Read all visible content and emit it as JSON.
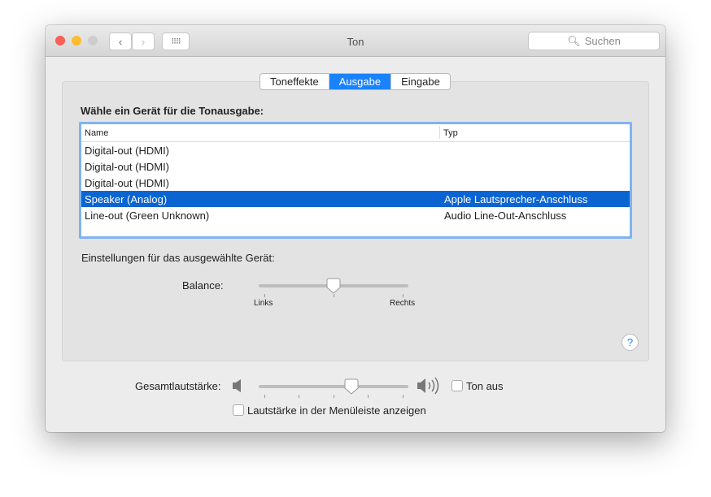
{
  "window": {
    "title": "Ton",
    "search_placeholder": "Suchen"
  },
  "tabs": [
    {
      "label": "Toneffekte",
      "selected": false
    },
    {
      "label": "Ausgabe",
      "selected": true
    },
    {
      "label": "Eingabe",
      "selected": false
    }
  ],
  "output": {
    "heading": "Wähle ein Gerät für die Tonausgabe:",
    "columns": [
      "Name",
      "Typ"
    ],
    "rows": [
      {
        "name": "Digital-out (HDMI)",
        "type": ""
      },
      {
        "name": "Digital-out (HDMI)",
        "type": ""
      },
      {
        "name": "Digital-out (HDMI)",
        "type": ""
      },
      {
        "name": "Speaker (Analog)",
        "type": "Apple Lautsprecher-Anschluss",
        "selected": true
      },
      {
        "name": "Line-out (Green Unknown)",
        "type": "Audio Line-Out-Anschluss"
      }
    ]
  },
  "settings": {
    "heading": "Einstellungen für das ausgewählte Gerät:",
    "balance_label": "Balance:",
    "balance_value_percent": 50,
    "left_label": "Links",
    "right_label": "Rechts"
  },
  "volume": {
    "label": "Gesamtlautstärke:",
    "value_percent": 62,
    "mute_label": "Ton aus",
    "mute_checked": false,
    "menubar_label": "Lautstärke in der Menüleiste anzeigen",
    "menubar_checked": false
  },
  "help": "?",
  "colors": {
    "accent": "#1a82fb",
    "selection": "#0a64d2"
  }
}
